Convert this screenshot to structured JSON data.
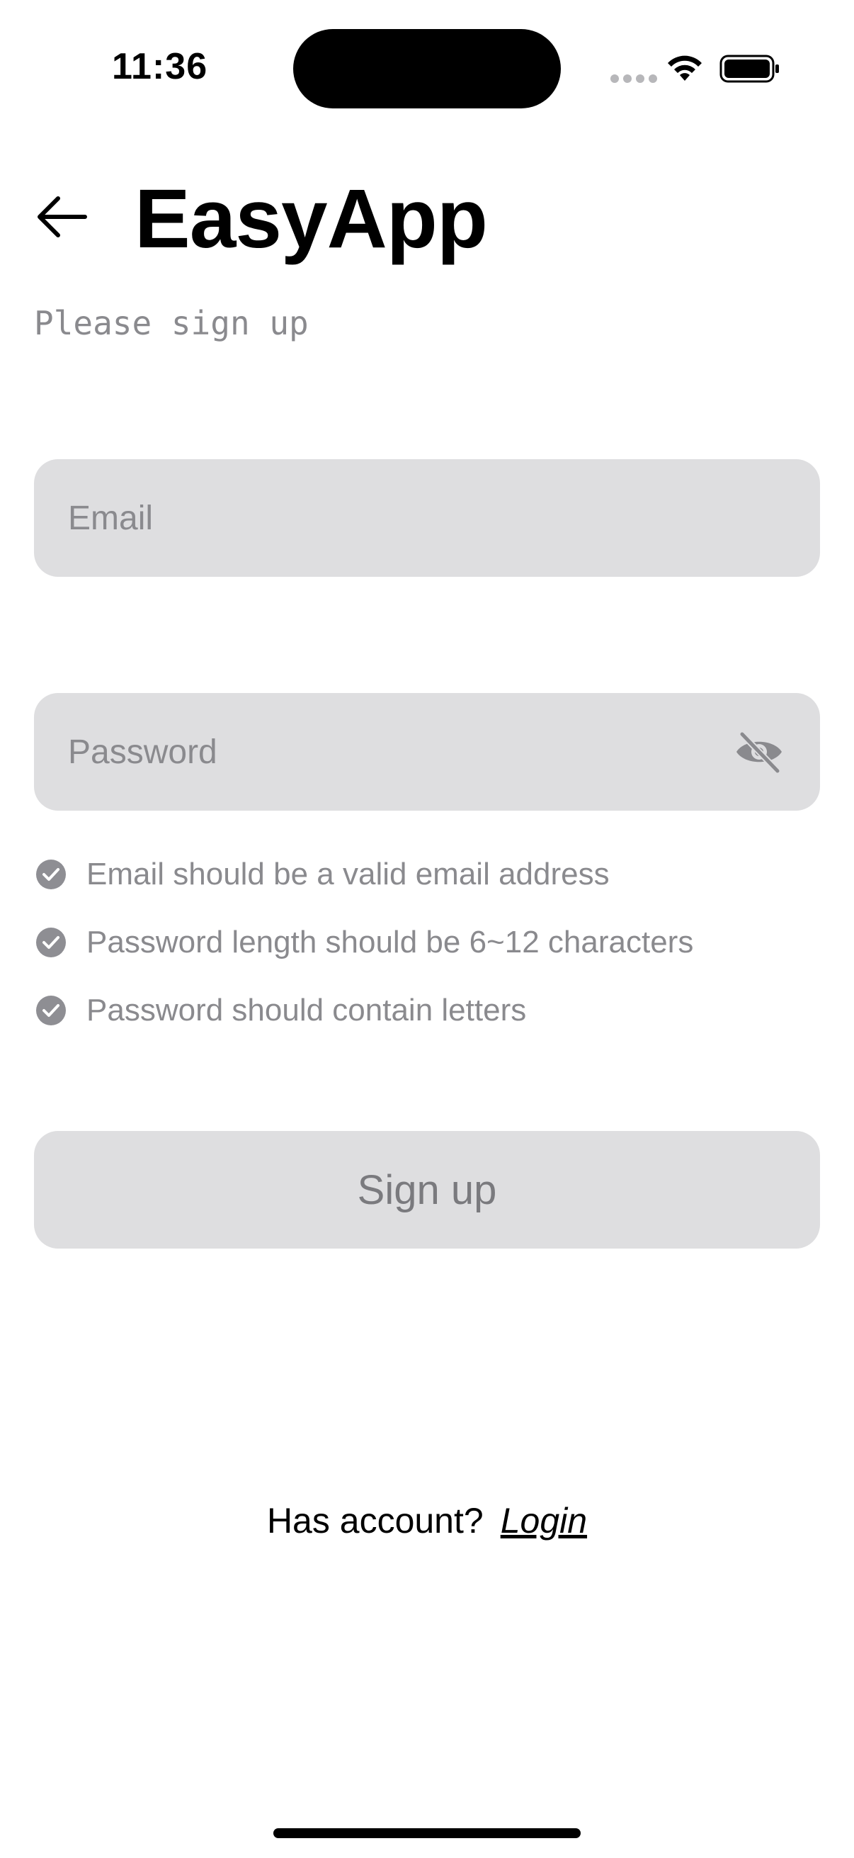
{
  "status_bar": {
    "time": "11:36"
  },
  "header": {
    "back_icon": "arrow-left-icon",
    "title": "EasyApp",
    "subtitle": "Please sign up"
  },
  "form": {
    "email": {
      "value": "",
      "placeholder": "Email"
    },
    "password": {
      "value": "",
      "placeholder": "Password",
      "visibility_icon": "eye-slash-icon"
    },
    "rules": [
      {
        "text": "Email should be a valid email address",
        "icon": "check-circle-icon"
      },
      {
        "text": "Password length should be 6~12 characters",
        "icon": "check-circle-icon"
      },
      {
        "text": "Password should contain letters",
        "icon": "check-circle-icon"
      }
    ],
    "submit_label": "Sign up"
  },
  "footer": {
    "prompt": "Has account?",
    "link_label": "Login"
  },
  "colors": {
    "field_background": "#dedee0",
    "muted_text": "#8a8a8e",
    "check_icon": "#8e8e93"
  }
}
